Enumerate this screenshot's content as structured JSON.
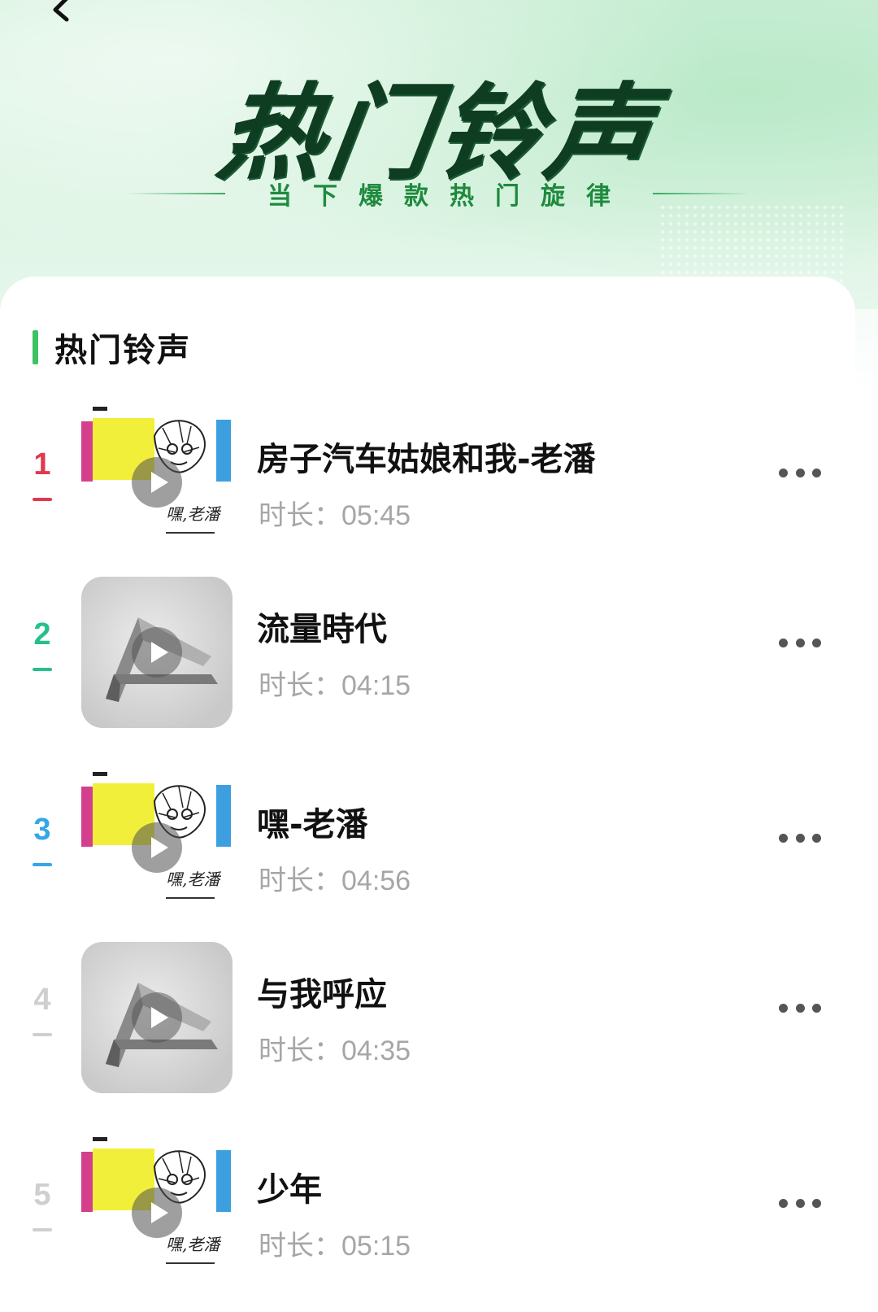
{
  "header": {
    "title": "热门铃声",
    "subtitle": "当下爆款热门旋律",
    "back_icon": "chevron-left-icon"
  },
  "section": {
    "title": "热门铃声",
    "accent": "#3dc363"
  },
  "songs": [
    {
      "rank": "1",
      "rank_color": "#e0394f",
      "title": "房子汽车姑娘和我-老潘",
      "duration": "时长：05:45",
      "cover": "sketch-art",
      "cover_sign": "嘿,老潘"
    },
    {
      "rank": "2",
      "rank_color": "#27c08a",
      "title": "流量時代",
      "duration": "时长：04:15",
      "cover": "metal-logo"
    },
    {
      "rank": "3",
      "rank_color": "#35a7e6",
      "title": "嘿-老潘",
      "duration": "时长：04:56",
      "cover": "sketch-art",
      "cover_sign": "嘿,老潘"
    },
    {
      "rank": "4",
      "rank_color": "#cfcfcf",
      "title": "与我呼应",
      "duration": "时长：04:35",
      "cover": "metal-logo"
    },
    {
      "rank": "5",
      "rank_color": "#cfcfcf",
      "title": "少年",
      "duration": "时长：05:15",
      "cover": "sketch-art",
      "cover_sign": "嘿,老潘"
    }
  ]
}
